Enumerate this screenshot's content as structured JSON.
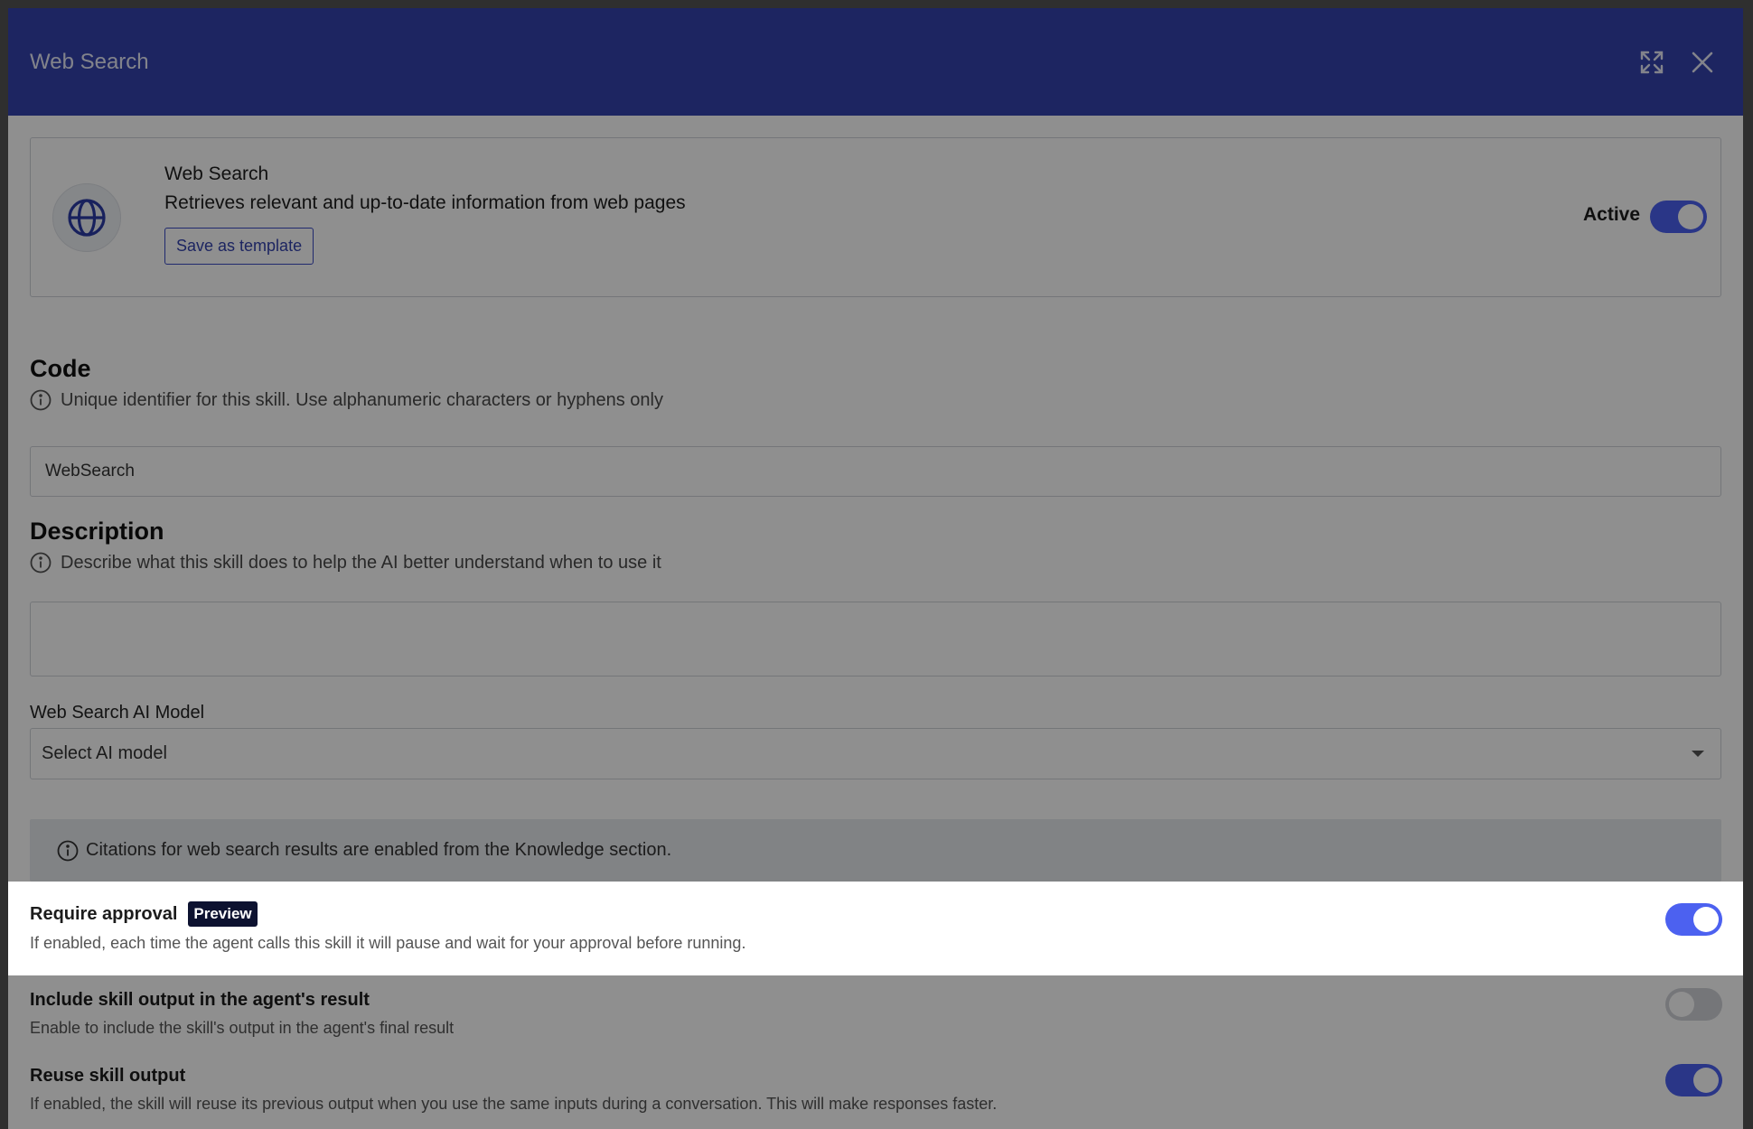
{
  "modal": {
    "title": "Web Search"
  },
  "skill": {
    "name": "Web Search",
    "description": "Retrieves relevant and up-to-date information from web pages",
    "save_template_label": "Save as template",
    "active_label": "Active",
    "active": true
  },
  "code": {
    "title": "Code",
    "hint": "Unique identifier for this skill. Use alphanumeric characters or hyphens only",
    "value": "WebSearch"
  },
  "description_field": {
    "title": "Description",
    "hint": "Describe what this skill does to help the AI better understand when to use it",
    "value": ""
  },
  "model": {
    "label": "Web Search AI Model",
    "placeholder": "Select AI model"
  },
  "notice": {
    "text": "Citations for web search results are enabled from the Knowledge section."
  },
  "options": [
    {
      "title": "Require approval",
      "badge": "Preview",
      "description": "If enabled, each time the agent calls this skill it will pause and wait for your approval before running.",
      "enabled": true
    },
    {
      "title": "Include skill output in the agent's result",
      "description": "Enable to include the skill's output in the agent's final result",
      "enabled": false
    },
    {
      "title": "Reuse skill output",
      "description": "If enabled, the skill will reuse its previous output when you use the same inputs during a conversation. This will make responses faster.",
      "enabled": true
    }
  ],
  "icons": {
    "expand": "expand-icon",
    "close": "close-icon",
    "globe": "globe-icon",
    "info": "info-icon"
  },
  "colors": {
    "header": "#3443ae",
    "accent": "#4c61f0",
    "badge": "#0d1230"
  }
}
